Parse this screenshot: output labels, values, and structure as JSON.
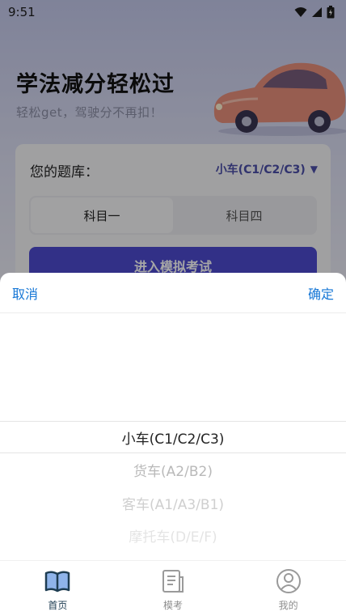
{
  "status_bar": {
    "time": "9:51"
  },
  "hero": {
    "title": "学法减分轻松过",
    "subtitle": "轻松get，驾驶分不再扣！"
  },
  "question_bank": {
    "label": "您的题库：",
    "selected": "小车(C1/C2/C3)",
    "tabs": [
      {
        "label": "科目一",
        "active": true
      },
      {
        "label": "科目四",
        "active": false
      }
    ],
    "start_button": "进入模拟考试"
  },
  "picker": {
    "cancel": "取消",
    "confirm": "确定",
    "options": [
      "小车(C1/C2/C3)",
      "货车(A2/B2)",
      "客车(A1/A3/B1)",
      "摩托车(D/E/F)"
    ],
    "selected_index": 0
  },
  "tabbar": {
    "items": [
      {
        "label": "首页",
        "icon": "book-icon",
        "active": true
      },
      {
        "label": "模考",
        "icon": "document-icon",
        "active": false
      },
      {
        "label": "我的",
        "icon": "user-icon",
        "active": false
      }
    ]
  },
  "colors": {
    "accent": "#4d4bd0",
    "link": "#1677d6",
    "picker_text": "#222222"
  }
}
